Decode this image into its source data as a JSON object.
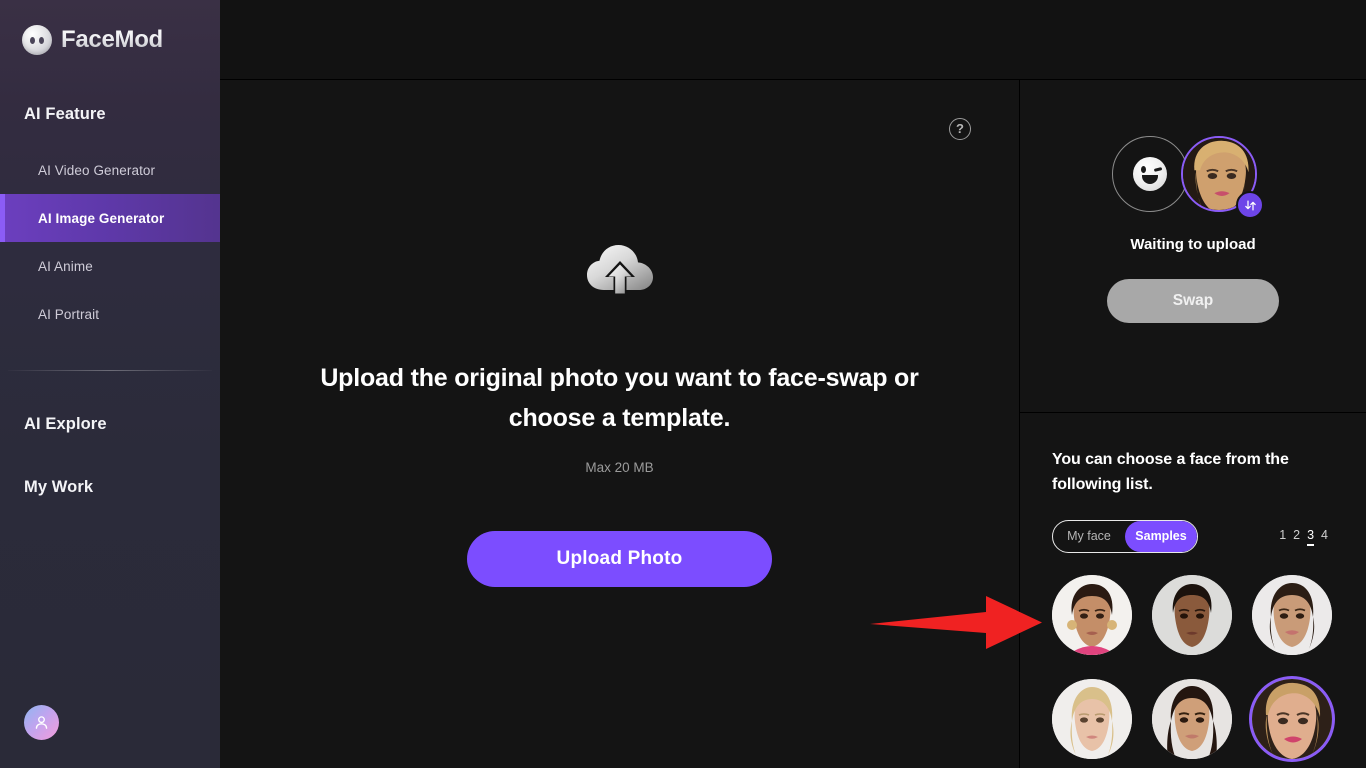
{
  "brand": {
    "name": "FaceMod",
    "logo_icon": "face-circle-icon"
  },
  "sidebar": {
    "sections": [
      {
        "title": "AI Feature"
      },
      {
        "title": "AI Explore"
      },
      {
        "title": "My Work"
      }
    ],
    "nav_items": [
      {
        "label": "AI Video Generator",
        "active": false
      },
      {
        "label": "AI Image Generator",
        "active": true
      },
      {
        "label": "AI Anime",
        "active": false
      },
      {
        "label": "AI Portrait",
        "active": false
      }
    ],
    "avatar_icon": "user-avatar-icon"
  },
  "center": {
    "help_icon": "question-mark-icon",
    "upload_icon": "cloud-upload-icon",
    "headline": "Upload the original photo you want to face-swap or choose a template.",
    "max_size_note": "Max 20 MB",
    "upload_button": "Upload Photo",
    "annotation_arrow": "red-arrow-pointing-right"
  },
  "right_panel": {
    "source_slot_icon": "winking-face-placeholder-icon",
    "target_slot_icon": "selected-face-thumbnail",
    "swap_toggle_icon": "swap-arrows-icon",
    "status": "Waiting to upload",
    "swap_button": "Swap",
    "chooser_title": "You can choose a face from the following list.",
    "segmented": {
      "options": [
        {
          "label": "My face",
          "active": false
        },
        {
          "label": "Samples",
          "active": true
        }
      ]
    },
    "pagination": {
      "pages": [
        "1",
        "2",
        "3",
        "4"
      ],
      "active": "3"
    },
    "faces": [
      {
        "name": "face-sample-1",
        "selected": false,
        "skin": "#c48e68",
        "hair": "#2a1a12",
        "bg": "#f3f1ee"
      },
      {
        "name": "face-sample-2",
        "selected": false,
        "skin": "#8a5a3c",
        "hair": "#1b120d",
        "bg": "#dcdcda"
      },
      {
        "name": "face-sample-3",
        "selected": false,
        "skin": "#c99b78",
        "hair": "#2b1d14",
        "bg": "#eceaea"
      },
      {
        "name": "face-sample-4",
        "selected": false,
        "skin": "#e8c2a8",
        "hair": "#d9c08a",
        "bg": "#f0eeec"
      },
      {
        "name": "face-sample-5",
        "selected": false,
        "skin": "#cf9f79",
        "hair": "#241610",
        "bg": "#e7e4e2"
      },
      {
        "name": "face-sample-6",
        "selected": true,
        "skin": "#e0ae8e",
        "hair": "#c9a067",
        "bg": "#2d2018"
      }
    ]
  },
  "colors": {
    "accent_purple": "#7c4dff",
    "accent_purple_ring": "#8b5cf6",
    "sidebar_bg": "#2e2b3c",
    "panel_bg": "#141414",
    "annotation_red": "#f02222"
  }
}
